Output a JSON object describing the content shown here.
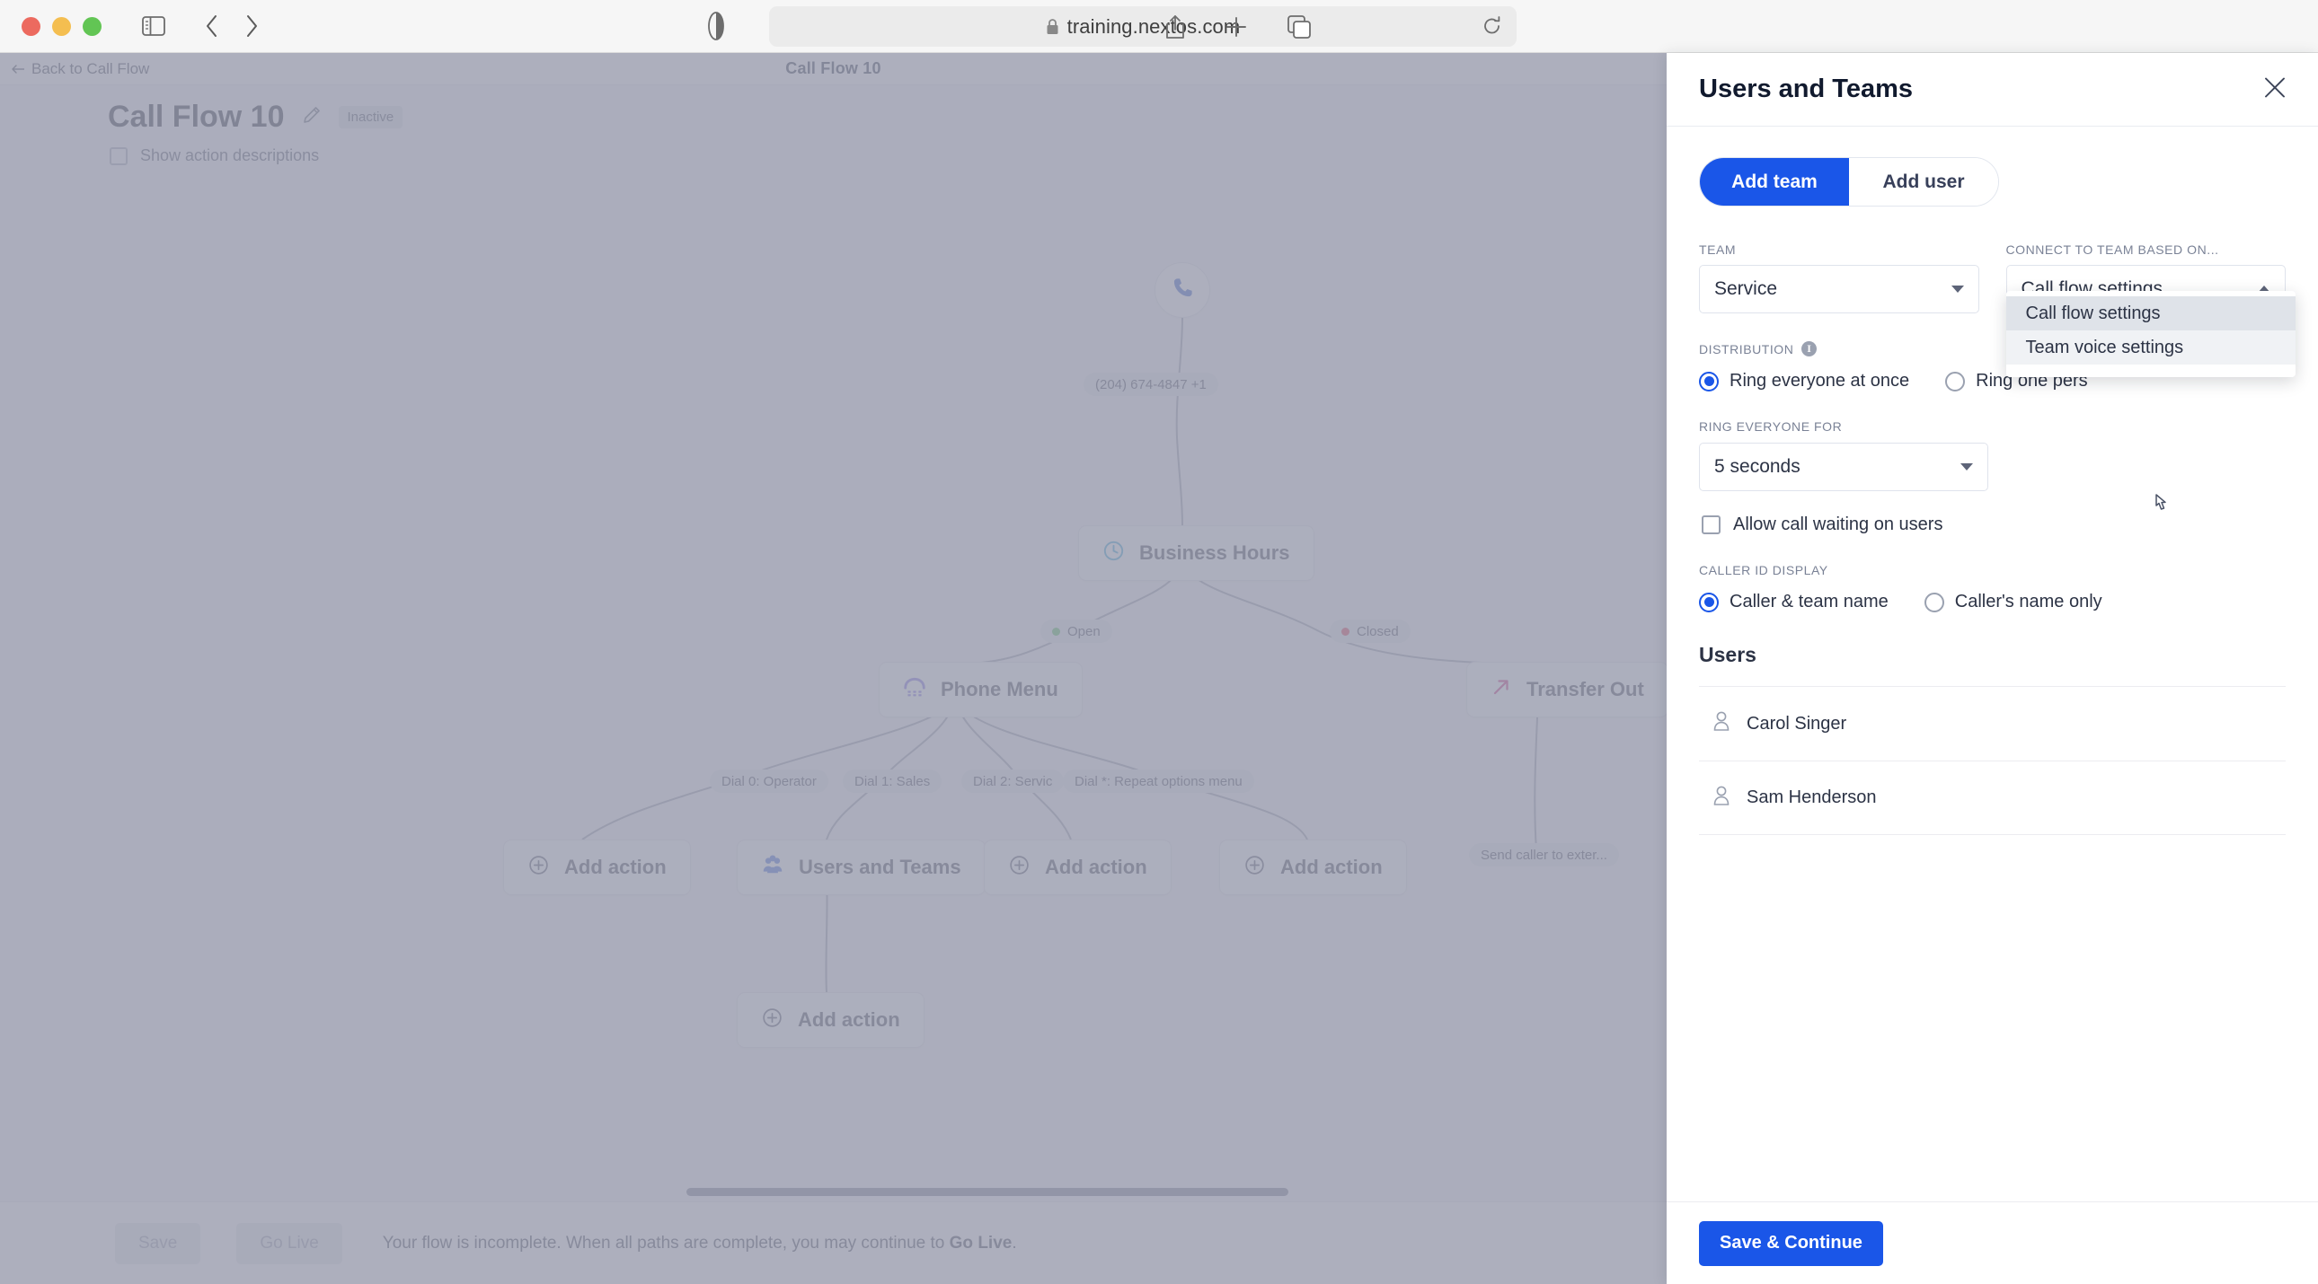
{
  "browser": {
    "url": "training.nextos.com",
    "lock_icon": "lock-icon",
    "reload_icon": "reload-icon",
    "sidebar_icon": "sidebar-toggle-icon",
    "back_icon": "back-arrow-icon",
    "forward_icon": "forward-arrow-icon",
    "share_icon": "share-icon",
    "newtab_icon": "plus-icon",
    "tabs_icon": "tab-overview-icon",
    "reader_icon": "reader-view-icon"
  },
  "subheader": {
    "back_label": "Back to Call Flow",
    "center_title": "Call Flow 10"
  },
  "flow_header": {
    "title": "Call Flow 10",
    "edit_icon": "pencil-icon",
    "status_badge": "Inactive",
    "show_descriptions_label": "Show action descriptions"
  },
  "canvas": {
    "start_node": {
      "icon": "phone-icon"
    },
    "nodes": [
      {
        "id": "business-hours",
        "label": "Business Hours",
        "icon": "clock-icon"
      },
      {
        "id": "phone-menu",
        "label": "Phone Menu",
        "icon": "phone-menu-icon"
      },
      {
        "id": "transfer-out",
        "label": "Transfer Out",
        "icon": "arrow-up-right-icon"
      },
      {
        "id": "add-action-1",
        "label": "Add action",
        "icon": "plus-circle-icon"
      },
      {
        "id": "users-and-teams",
        "label": "Users and Teams",
        "icon": "users-teams-icon"
      },
      {
        "id": "add-action-2",
        "label": "Add action",
        "icon": "plus-circle-icon"
      },
      {
        "id": "add-action-3",
        "label": "Add action",
        "icon": "plus-circle-icon"
      },
      {
        "id": "add-action-4",
        "label": "Add action",
        "icon": "plus-circle-icon"
      }
    ],
    "pills": [
      {
        "id": "phone-number",
        "label": "(204) 674-4847 +1",
        "dot": ""
      },
      {
        "id": "open",
        "label": "Open",
        "dot": "#3cb54a"
      },
      {
        "id": "closed",
        "label": "Closed",
        "dot": "#d6263c"
      },
      {
        "id": "dial0",
        "label": "Dial 0: Operator",
        "dot": ""
      },
      {
        "id": "dial1",
        "label": "Dial 1: Sales",
        "dot": ""
      },
      {
        "id": "dial2",
        "label": "Dial 2: Servic",
        "dot": ""
      },
      {
        "id": "dialstar",
        "label": "Dial *: Repeat options menu",
        "dot": ""
      },
      {
        "id": "send-external",
        "label": "Send caller to exter...",
        "dot": ""
      }
    ]
  },
  "flow_footer": {
    "save_label": "Save",
    "golive_label": "Go Live",
    "note_prefix": "Your flow is incomplete. When all paths are complete, you may continue to ",
    "note_bold": "Go Live",
    "note_suffix": "."
  },
  "panel": {
    "title": "Users and Teams",
    "close_icon": "close-icon",
    "tabs": [
      {
        "label": "Add team",
        "active": true
      },
      {
        "label": "Add user",
        "active": false
      }
    ],
    "team_label": "TEAM",
    "team_value": "Service",
    "connect_label": "CONNECT TO TEAM BASED ON...",
    "connect_value": "Call flow settings",
    "connect_options": [
      {
        "label": "Call flow settings",
        "state": "selected"
      },
      {
        "label": "Team voice settings",
        "state": "hovered"
      }
    ],
    "distribution_label": "DISTRIBUTION",
    "distribution_info_icon": "info-icon",
    "distribution_options": [
      {
        "label": "Ring everyone at once",
        "selected": true
      },
      {
        "label": "Ring one pers",
        "selected": false
      }
    ],
    "ring_for_label": "RING EVERYONE FOR",
    "ring_for_value": "5 seconds",
    "call_waiting_label": "Allow call waiting on users",
    "call_waiting_checked": false,
    "caller_id_label": "CALLER ID DISPLAY",
    "caller_id_options": [
      {
        "label": "Caller & team name",
        "selected": true
      },
      {
        "label": "Caller's name only",
        "selected": false
      }
    ],
    "users_heading": "Users",
    "users": [
      {
        "name": "Carol Singer",
        "icon": "user-icon"
      },
      {
        "name": "Sam Henderson",
        "icon": "user-icon"
      }
    ],
    "save_continue_label": "Save & Continue"
  },
  "colors": {
    "accent": "#1a56e8",
    "open": "#3cb54a",
    "closed": "#d6263c",
    "scrim": "#9b9daf"
  }
}
